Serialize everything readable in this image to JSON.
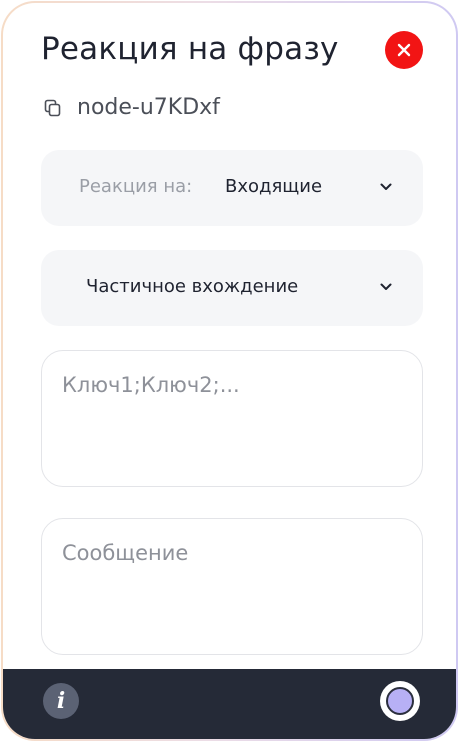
{
  "panel": {
    "title": "Реакция на фразу",
    "node_id": "node-u7KDxf"
  },
  "icons": {
    "close": "close-icon",
    "copy": "copy-icon",
    "chevron": "chevron-down-icon",
    "info": "info-icon",
    "status": "status-circle-icon"
  },
  "reaction_select": {
    "prefix": "Реакция на:",
    "value": "Входящие"
  },
  "match_select": {
    "value": "Частичное вхождение"
  },
  "keys_field": {
    "placeholder": "Ключ1;Ключ2;..."
  },
  "message_field": {
    "placeholder": "Сообщение"
  },
  "footer": {
    "info_glyph": "i"
  },
  "colors": {
    "close_button": "#f21414",
    "footer_bg": "#252a37",
    "status_fill": "#b7b0f5",
    "select_bg": "#f5f6f8"
  }
}
